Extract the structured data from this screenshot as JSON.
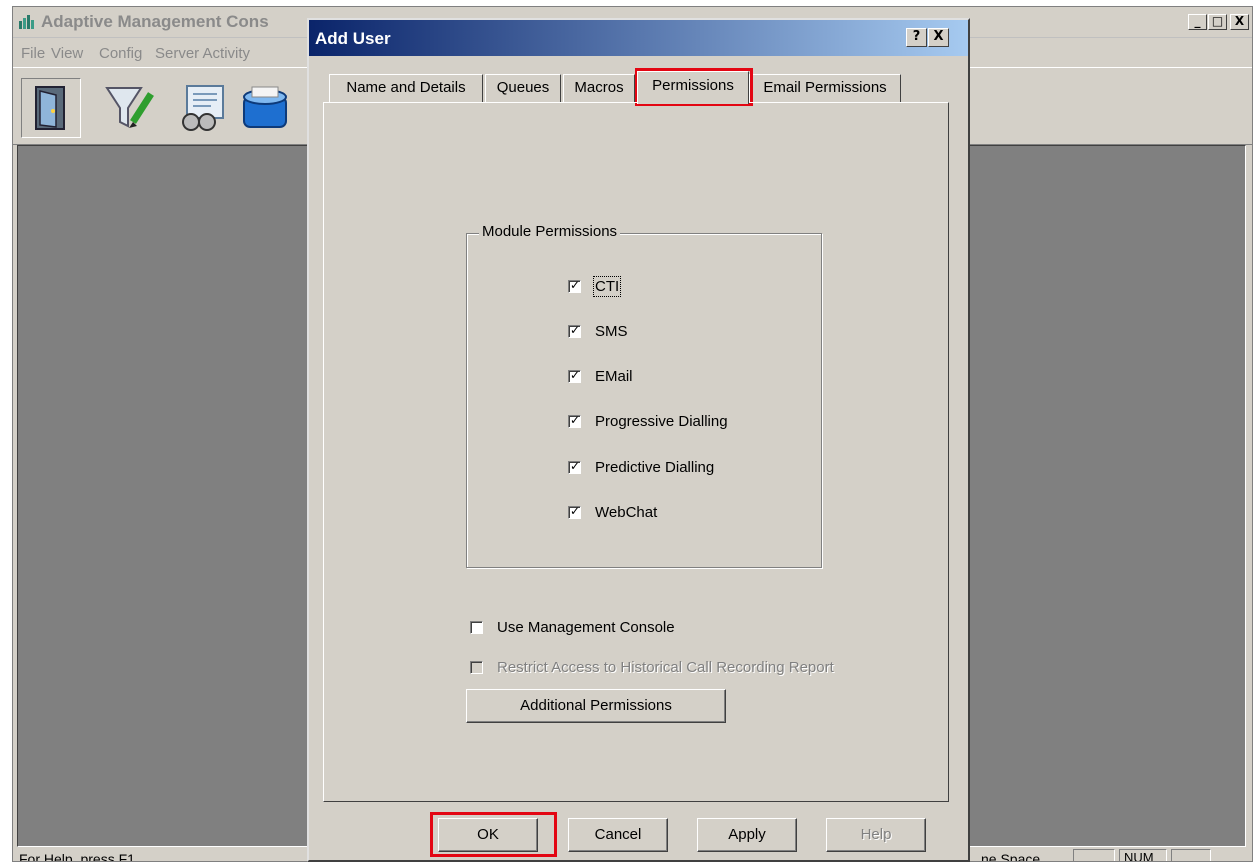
{
  "main_window": {
    "title": "Adaptive Management Cons",
    "controls": {
      "minimize": "_",
      "maximize": "□",
      "close": "X"
    },
    "menu": [
      {
        "label": "File"
      },
      {
        "label": "View"
      },
      {
        "label": "Config"
      },
      {
        "label": "Server Activity"
      }
    ],
    "toolbar": [
      {
        "icon": "door-icon"
      },
      {
        "icon": "filter-funnel-icon"
      },
      {
        "icon": "report-binoculars-icon"
      },
      {
        "icon": "database-icon"
      }
    ],
    "status": {
      "help_text": "For Help, press F1",
      "pane_text": "ne Space",
      "num": "NUM"
    }
  },
  "dialog": {
    "title": "Add User",
    "help_button": "?",
    "close_button": "X",
    "tabs": [
      {
        "label": "Name and Details"
      },
      {
        "label": "Queues"
      },
      {
        "label": "Macros"
      },
      {
        "label": "Permissions",
        "active": true
      },
      {
        "label": "Email Permissions"
      }
    ],
    "module_permissions": {
      "title": "Module Permissions",
      "items": [
        {
          "label": "CTI",
          "checked": true
        },
        {
          "label": "SMS",
          "checked": true
        },
        {
          "label": "EMail",
          "checked": true
        },
        {
          "label": "Progressive Dialling",
          "checked": true
        },
        {
          "label": "Predictive Dialling",
          "checked": true
        },
        {
          "label": "WebChat",
          "checked": true
        }
      ]
    },
    "use_management_console": {
      "label": "Use Management Console",
      "checked": false
    },
    "restrict_access": {
      "label": "Restrict Access to Historical Call Recording Report",
      "checked": false,
      "enabled": false
    },
    "additional_permissions_button": "Additional Permissions",
    "buttons": {
      "ok": "OK",
      "cancel": "Cancel",
      "apply": "Apply",
      "help": "Help"
    }
  },
  "colors": {
    "highlight": "#e30613",
    "title_bar": "#0a246a",
    "face": "#d4d0c8"
  }
}
